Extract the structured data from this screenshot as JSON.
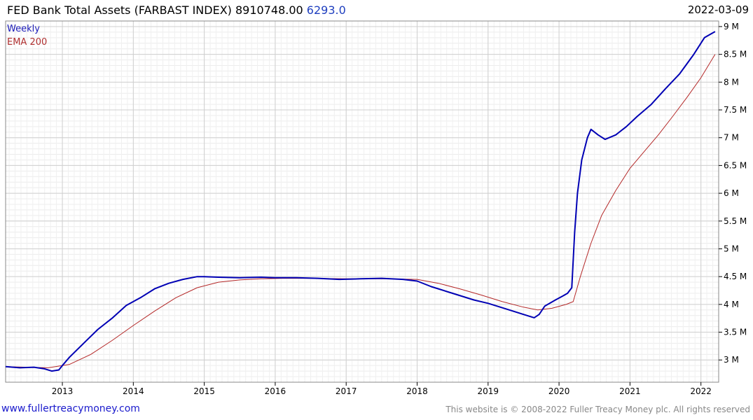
{
  "header": {
    "title": "FED Bank Total Assets (FARBAST INDEX) 8910748.00",
    "change": "6293.0",
    "date": "2022-03-09"
  },
  "legend": {
    "weekly": "Weekly",
    "ema": "EMA 200"
  },
  "footer": {
    "left": "www.fullertreacymoney.com",
    "right": "This website is © 2008-2022 Fuller Treacy Money plc. All rights reserved"
  },
  "colors": {
    "weekly": "#0000b4",
    "ema": "#b42828",
    "change": "#1f3fbf"
  },
  "chart_data": {
    "type": "line",
    "x_ticks": [
      "2013",
      "2014",
      "2015",
      "2016",
      "2017",
      "2018",
      "2019",
      "2020",
      "2021",
      "2022"
    ],
    "y_ticks": [
      "3 M",
      "3.5 M",
      "4 M",
      "4.5 M",
      "5 M",
      "5.5 M",
      "6 M",
      "6.5 M",
      "7 M",
      "7.5 M",
      "8 M",
      "8.5 M",
      "9 M"
    ],
    "ylim": [
      2.6,
      9.1
    ],
    "xlim": [
      2012.2,
      2022.25
    ],
    "grid": true,
    "legend_position": "top-left",
    "series": [
      {
        "name": "Weekly",
        "points": [
          [
            2012.2,
            2.88
          ],
          [
            2012.4,
            2.86
          ],
          [
            2012.6,
            2.87
          ],
          [
            2012.75,
            2.84
          ],
          [
            2012.85,
            2.8
          ],
          [
            2012.95,
            2.82
          ],
          [
            2013.0,
            2.9
          ],
          [
            2013.1,
            3.05
          ],
          [
            2013.3,
            3.3
          ],
          [
            2013.5,
            3.55
          ],
          [
            2013.7,
            3.75
          ],
          [
            2013.9,
            3.98
          ],
          [
            2014.1,
            4.12
          ],
          [
            2014.3,
            4.28
          ],
          [
            2014.5,
            4.38
          ],
          [
            2014.7,
            4.45
          ],
          [
            2014.9,
            4.5
          ],
          [
            2015.0,
            4.5
          ],
          [
            2015.2,
            4.49
          ],
          [
            2015.5,
            4.48
          ],
          [
            2015.8,
            4.49
          ],
          [
            2016.0,
            4.48
          ],
          [
            2016.3,
            4.48
          ],
          [
            2016.6,
            4.47
          ],
          [
            2016.9,
            4.45
          ],
          [
            2017.2,
            4.46
          ],
          [
            2017.5,
            4.47
          ],
          [
            2017.8,
            4.45
          ],
          [
            2018.0,
            4.42
          ],
          [
            2018.2,
            4.32
          ],
          [
            2018.5,
            4.2
          ],
          [
            2018.8,
            4.08
          ],
          [
            2019.0,
            4.02
          ],
          [
            2019.3,
            3.9
          ],
          [
            2019.5,
            3.82
          ],
          [
            2019.65,
            3.76
          ],
          [
            2019.72,
            3.82
          ],
          [
            2019.8,
            3.97
          ],
          [
            2019.95,
            4.08
          ],
          [
            2020.05,
            4.15
          ],
          [
            2020.12,
            4.2
          ],
          [
            2020.18,
            4.3
          ],
          [
            2020.22,
            5.3
          ],
          [
            2020.26,
            6.0
          ],
          [
            2020.32,
            6.6
          ],
          [
            2020.4,
            7.0
          ],
          [
            2020.45,
            7.15
          ],
          [
            2020.55,
            7.05
          ],
          [
            2020.65,
            6.97
          ],
          [
            2020.8,
            7.05
          ],
          [
            2020.95,
            7.2
          ],
          [
            2021.1,
            7.38
          ],
          [
            2021.3,
            7.6
          ],
          [
            2021.5,
            7.88
          ],
          [
            2021.7,
            8.15
          ],
          [
            2021.9,
            8.5
          ],
          [
            2022.05,
            8.8
          ],
          [
            2022.2,
            8.91
          ]
        ]
      },
      {
        "name": "EMA 200",
        "points": [
          [
            2012.2,
            2.88
          ],
          [
            2012.5,
            2.87
          ],
          [
            2012.8,
            2.86
          ],
          [
            2013.1,
            2.92
          ],
          [
            2013.4,
            3.1
          ],
          [
            2013.7,
            3.35
          ],
          [
            2014.0,
            3.62
          ],
          [
            2014.3,
            3.88
          ],
          [
            2014.6,
            4.12
          ],
          [
            2014.9,
            4.3
          ],
          [
            2015.2,
            4.4
          ],
          [
            2015.5,
            4.44
          ],
          [
            2015.8,
            4.46
          ],
          [
            2016.1,
            4.47
          ],
          [
            2016.5,
            4.47
          ],
          [
            2017.0,
            4.46
          ],
          [
            2017.5,
            4.46
          ],
          [
            2018.0,
            4.45
          ],
          [
            2018.3,
            4.38
          ],
          [
            2018.6,
            4.28
          ],
          [
            2018.9,
            4.17
          ],
          [
            2019.2,
            4.05
          ],
          [
            2019.5,
            3.95
          ],
          [
            2019.7,
            3.9
          ],
          [
            2019.9,
            3.93
          ],
          [
            2020.1,
            4.0
          ],
          [
            2020.2,
            4.05
          ],
          [
            2020.3,
            4.5
          ],
          [
            2020.45,
            5.1
          ],
          [
            2020.6,
            5.6
          ],
          [
            2020.8,
            6.05
          ],
          [
            2021.0,
            6.45
          ],
          [
            2021.2,
            6.75
          ],
          [
            2021.4,
            7.05
          ],
          [
            2021.6,
            7.38
          ],
          [
            2021.8,
            7.72
          ],
          [
            2022.0,
            8.08
          ],
          [
            2022.2,
            8.5
          ]
        ]
      }
    ]
  }
}
